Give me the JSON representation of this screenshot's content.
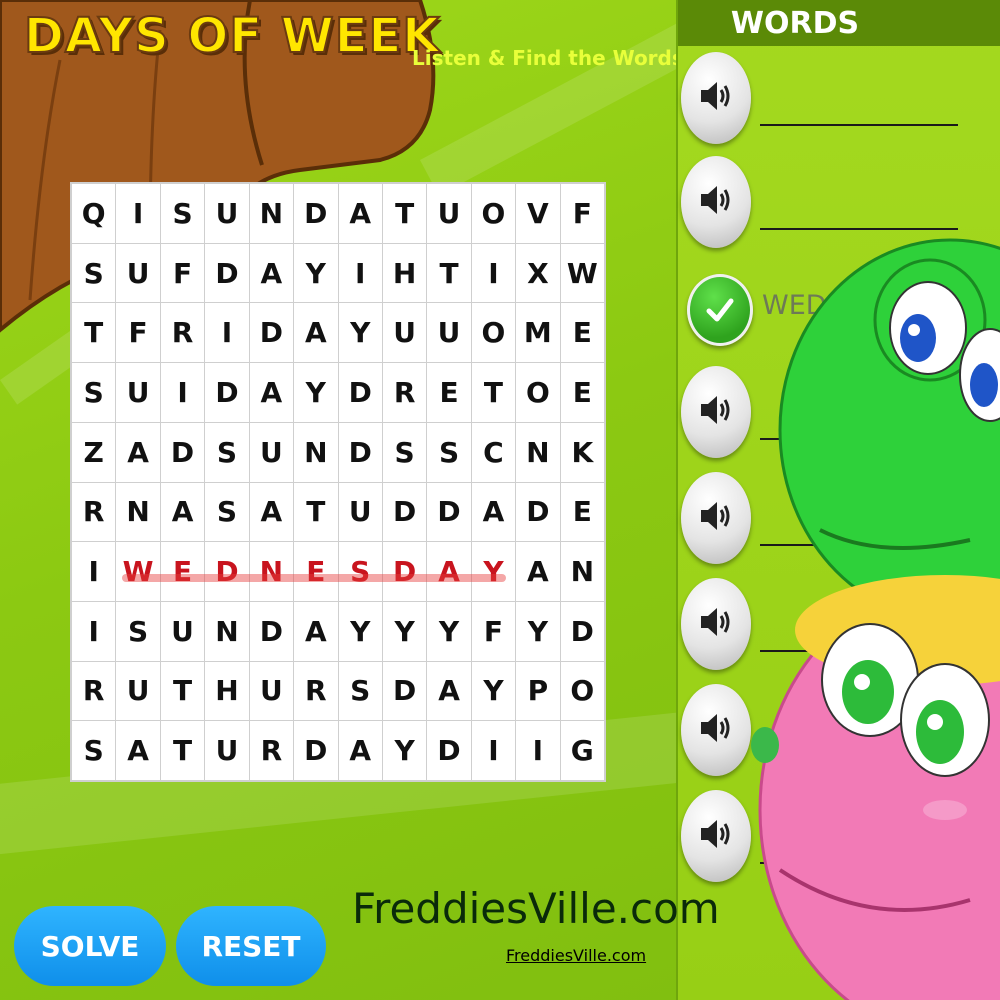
{
  "header": {
    "title": "DAYS OF WEEK",
    "subtitle": "Listen & Find the Words"
  },
  "grid": {
    "rows": [
      [
        "Q",
        "I",
        "S",
        "U",
        "N",
        "D",
        "A",
        "T",
        "U",
        "O",
        "V",
        "F"
      ],
      [
        "S",
        "U",
        "F",
        "D",
        "A",
        "Y",
        "I",
        "H",
        "T",
        "I",
        "X",
        "W"
      ],
      [
        "T",
        "F",
        "R",
        "I",
        "D",
        "A",
        "Y",
        "U",
        "U",
        "O",
        "M",
        "E"
      ],
      [
        "S",
        "U",
        "I",
        "D",
        "A",
        "Y",
        "D",
        "R",
        "E",
        "T",
        "O",
        "E"
      ],
      [
        "Z",
        "A",
        "D",
        "S",
        "U",
        "N",
        "D",
        "S",
        "S",
        "C",
        "N",
        "K"
      ],
      [
        "R",
        "N",
        "A",
        "S",
        "A",
        "T",
        "U",
        "D",
        "D",
        "A",
        "D",
        "E"
      ],
      [
        "I",
        "W",
        "E",
        "D",
        "N",
        "E",
        "S",
        "D",
        "A",
        "Y",
        "A",
        "N"
      ],
      [
        "I",
        "S",
        "U",
        "N",
        "D",
        "A",
        "Y",
        "Y",
        "Y",
        "F",
        "Y",
        "D"
      ],
      [
        "R",
        "U",
        "T",
        "H",
        "U",
        "R",
        "S",
        "D",
        "A",
        "Y",
        "P",
        "O"
      ],
      [
        "S",
        "A",
        "T",
        "U",
        "R",
        "D",
        "A",
        "Y",
        "D",
        "I",
        "I",
        "G"
      ]
    ],
    "found_word": "WEDNESDAY",
    "found_row": 6,
    "found_cols": [
      1,
      9
    ]
  },
  "word_list": {
    "header": "WORDS",
    "items": [
      {
        "status": "hidden",
        "icon": "speaker-icon",
        "text": ""
      },
      {
        "status": "hidden",
        "icon": "speaker-icon",
        "text": ""
      },
      {
        "status": "found",
        "icon": "checkmark-icon",
        "text": "WEDNESDAY"
      },
      {
        "status": "hidden",
        "icon": "speaker-icon",
        "text": ""
      },
      {
        "status": "hidden",
        "icon": "speaker-icon",
        "text": ""
      },
      {
        "status": "hidden",
        "icon": "speaker-icon",
        "text": ""
      },
      {
        "status": "hidden",
        "icon": "speaker-icon",
        "text": ""
      },
      {
        "status": "hidden",
        "icon": "speaker-icon",
        "text": ""
      }
    ]
  },
  "buttons": {
    "solve": "SOLVE",
    "reset": "RESET"
  },
  "branding": {
    "logo_text": "FreddiesVille.com",
    "link_text": "FreddiesVille.com"
  },
  "colors": {
    "background": "#8cc912",
    "title": "#ffe600",
    "found_letters": "#c8141e",
    "button": "#1aa0f5",
    "panel_header": "#5b8a07"
  }
}
